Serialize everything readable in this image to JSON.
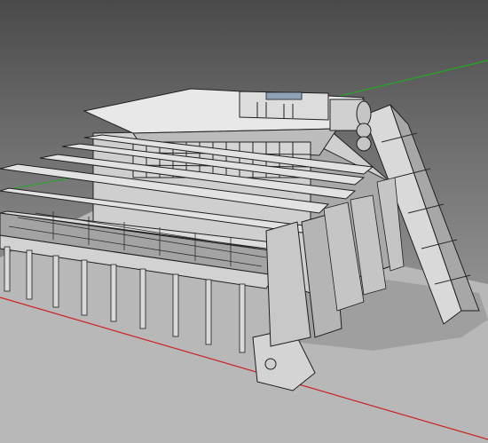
{
  "viewport": {
    "view_mode": "3d-perspective",
    "render_style": "shaded-gray",
    "background": {
      "top_color": "#4a4a4a",
      "bottom_color": "#b9b9b9"
    },
    "ground_plane_color": "#b9b9b9",
    "axes": [
      {
        "name": "x-axis",
        "color": "#cc2222"
      },
      {
        "name": "y-axis",
        "color": "#22aa22"
      }
    ],
    "model": {
      "description_visible": false,
      "colors": {
        "light": "#e6e6e6",
        "mid": "#bdbdbd",
        "dark": "#6a6a6a",
        "edge": "#1f1f1f",
        "glass": "#8fa2b8"
      }
    }
  }
}
